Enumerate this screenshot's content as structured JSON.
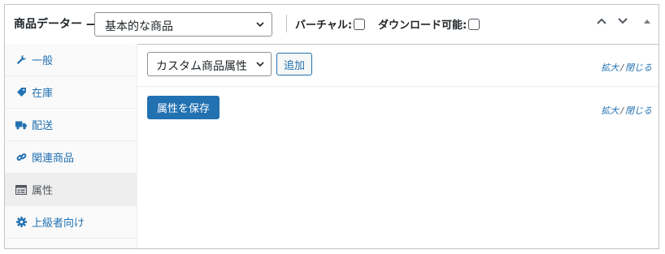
{
  "header": {
    "title": "商品データー —",
    "product_type_value": "基本的な商品",
    "virtual_label": "バーチャル:",
    "downloadable_label": "ダウンロード可能:"
  },
  "sidebar": {
    "items": [
      {
        "label": "一般",
        "icon": "wrench-icon"
      },
      {
        "label": "在庫",
        "icon": "tag-icon"
      },
      {
        "label": "配送",
        "icon": "truck-icon"
      },
      {
        "label": "関連商品",
        "icon": "link-icon"
      },
      {
        "label": "属性",
        "icon": "list-view-icon",
        "active": true
      },
      {
        "label": "上級者向け",
        "icon": "gear-icon"
      }
    ]
  },
  "attributes": {
    "select_value": "カスタム商品属性",
    "add_label": "追加",
    "expand_label": "拡大",
    "separator": "/",
    "close_label": "閉じる",
    "save_label": "属性を保存"
  },
  "colors": {
    "accent": "#2271b1",
    "border": "#c3c4c7",
    "sidebar_bg": "#fafafa",
    "active_tab_bg": "#eeeeee"
  }
}
